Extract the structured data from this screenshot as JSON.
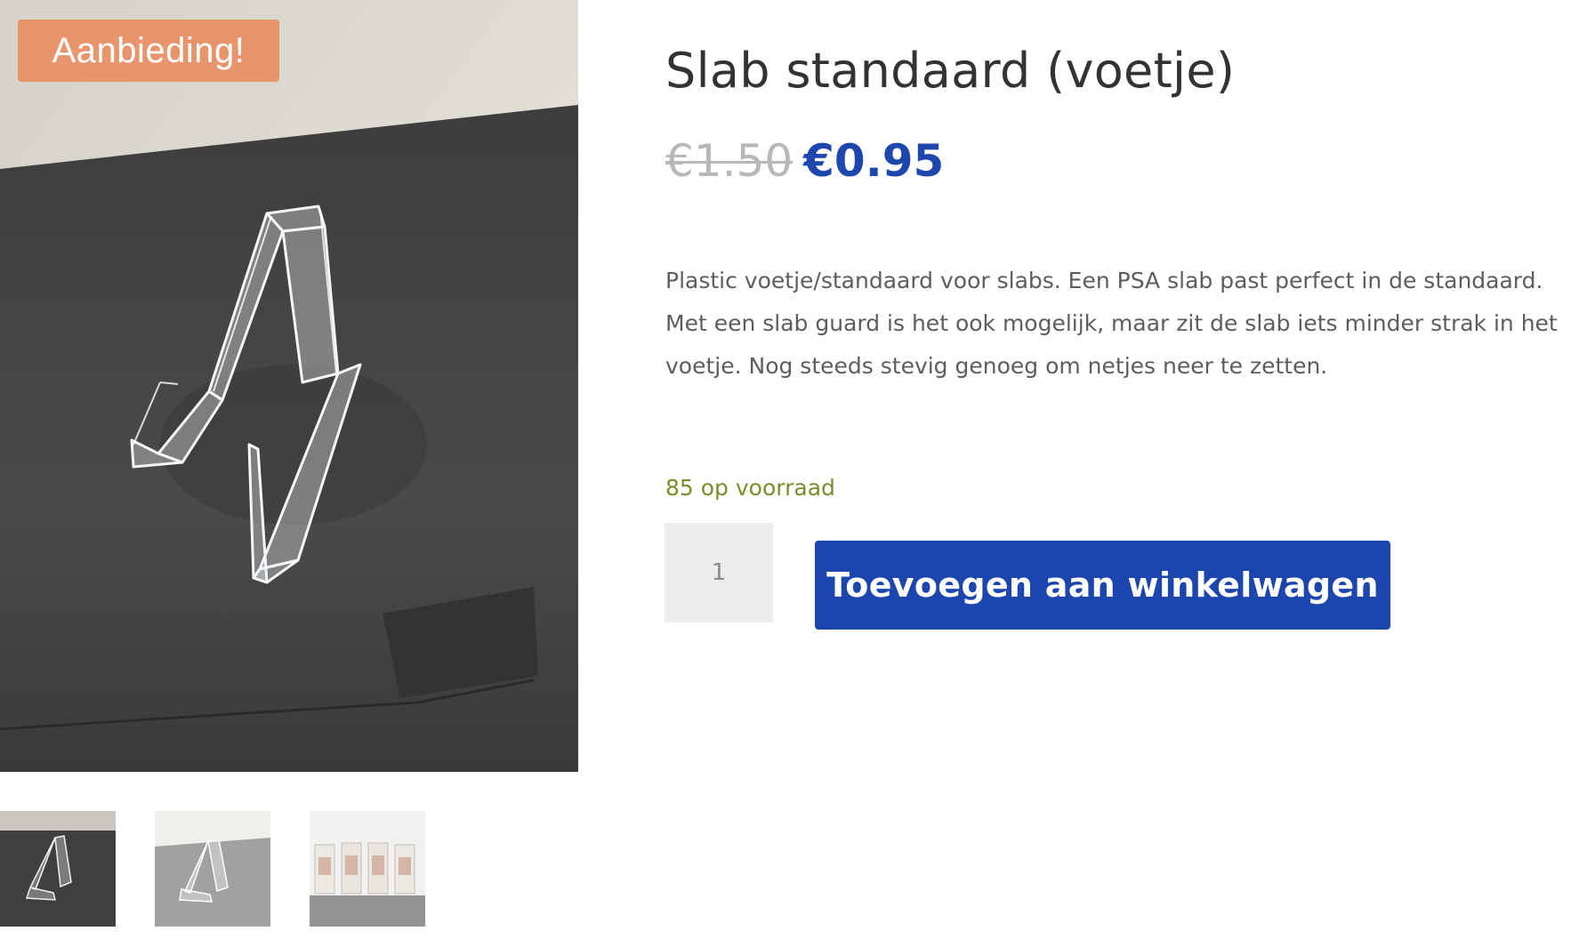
{
  "badge": {
    "label": "Aanbieding!"
  },
  "product": {
    "title": "Slab standaard (voetje)",
    "price_old": "€1.50",
    "price_new": "€0.95",
    "description": "Plastic voetje/standaard voor slabs. Een PSA slab past perfect in de standaard. Met een slab guard is het ook mogelijk, maar zit de slab iets minder strak in het voetje. Nog steeds stevig genoeg om netjes neer te zetten.",
    "stock": "85 op voorraad"
  },
  "cart": {
    "quantity": "1",
    "button_label": "Toevoegen aan winkelwagen"
  },
  "gallery": {
    "thumbnails": [
      {
        "name": "thumbnail-stand-dark",
        "active": true
      },
      {
        "name": "thumbnail-stand-grey",
        "active": false
      },
      {
        "name": "thumbnail-slabs-display",
        "active": false
      }
    ]
  },
  "colors": {
    "badge": "#e8956d",
    "price_new": "#1e47ad",
    "button": "#1c45ad",
    "stock": "#7f8a2b",
    "title": "#333333"
  }
}
